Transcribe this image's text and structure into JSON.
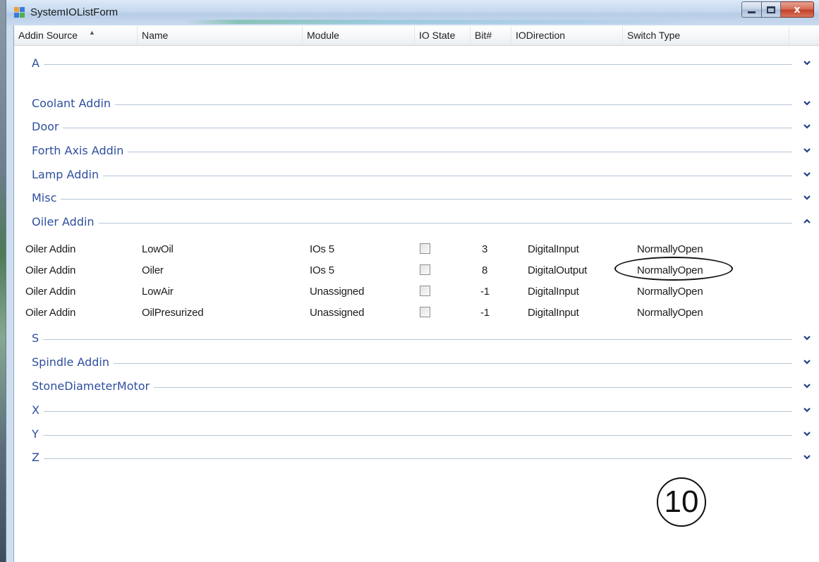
{
  "window": {
    "title": "SystemIOListForm",
    "caption_buttons": {
      "minimize": "minimize",
      "maximize": "maximize",
      "close": "x"
    }
  },
  "columns": [
    "Addin Source",
    "Name",
    "Module",
    "IO State",
    "Bit#",
    "IODirection",
    "Switch Type"
  ],
  "groups_before": [
    {
      "label": "A",
      "expanded": false
    },
    {
      "label": "Coolant Addin",
      "expanded": false
    },
    {
      "label": "Door",
      "expanded": false
    },
    {
      "label": "Forth Axis Addin",
      "expanded": false
    },
    {
      "label": "Lamp Addin",
      "expanded": false
    },
    {
      "label": "Misc",
      "expanded": false
    }
  ],
  "expanded_group": {
    "label": "Oiler Addin",
    "expanded": true,
    "rows": [
      {
        "source": "Oiler Addin",
        "name": "LowOil",
        "module": "IOs 5",
        "io_state": false,
        "bit": "3",
        "direction": "DigitalInput",
        "switch": "NormallyOpen"
      },
      {
        "source": "Oiler Addin",
        "name": "Oiler",
        "module": "IOs 5",
        "io_state": false,
        "bit": "8",
        "direction": "DigitalOutput",
        "switch": "NormallyOpen"
      },
      {
        "source": "Oiler Addin",
        "name": "LowAir",
        "module": "Unassigned",
        "io_state": false,
        "bit": "-1",
        "direction": "DigitalInput",
        "switch": "NormallyOpen"
      },
      {
        "source": "Oiler Addin",
        "name": "OilPresurized",
        "module": "Unassigned",
        "io_state": false,
        "bit": "-1",
        "direction": "DigitalInput",
        "switch": "NormallyOpen"
      }
    ]
  },
  "groups_after": [
    {
      "label": "S",
      "expanded": false
    },
    {
      "label": "Spindle Addin",
      "expanded": false
    },
    {
      "label": "StoneDiameterMotor",
      "expanded": false
    },
    {
      "label": "X",
      "expanded": false
    },
    {
      "label": "Y",
      "expanded": false
    },
    {
      "label": "Z",
      "expanded": false
    }
  ],
  "annotation": {
    "step_number": "10",
    "highlighted_cell": "NormallyOpen"
  },
  "colors": {
    "group_text": "#2e4f9e",
    "chevron": "#1f3f86",
    "title_bar": "#c5d8ee"
  }
}
